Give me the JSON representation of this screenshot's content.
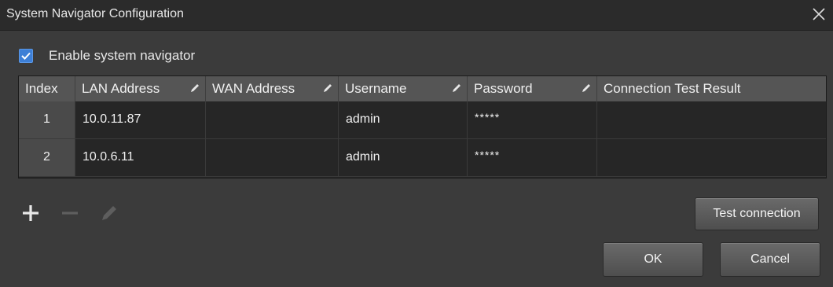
{
  "window": {
    "title": "System Navigator Configuration"
  },
  "options": {
    "enable_label": "Enable system navigator",
    "enable_checked": true
  },
  "table": {
    "headers": [
      "Index",
      "LAN Address",
      "WAN Address",
      "Username",
      "Password",
      "Connection Test Result"
    ],
    "rows": [
      {
        "index": "1",
        "lan": "10.0.11.87",
        "wan": "",
        "username": "admin",
        "password": "*****",
        "result": ""
      },
      {
        "index": "2",
        "lan": "10.0.6.11",
        "wan": "",
        "username": "admin",
        "password": "*****",
        "result": ""
      }
    ]
  },
  "toolbar": {
    "add": "add-icon",
    "remove": "remove-icon",
    "edit": "pencil-icon"
  },
  "buttons": {
    "test": "Test connection",
    "ok": "OK",
    "cancel": "Cancel"
  },
  "colors": {
    "accent": "#3d7fd6",
    "background": "#3b3b3b",
    "header": "#555555"
  }
}
